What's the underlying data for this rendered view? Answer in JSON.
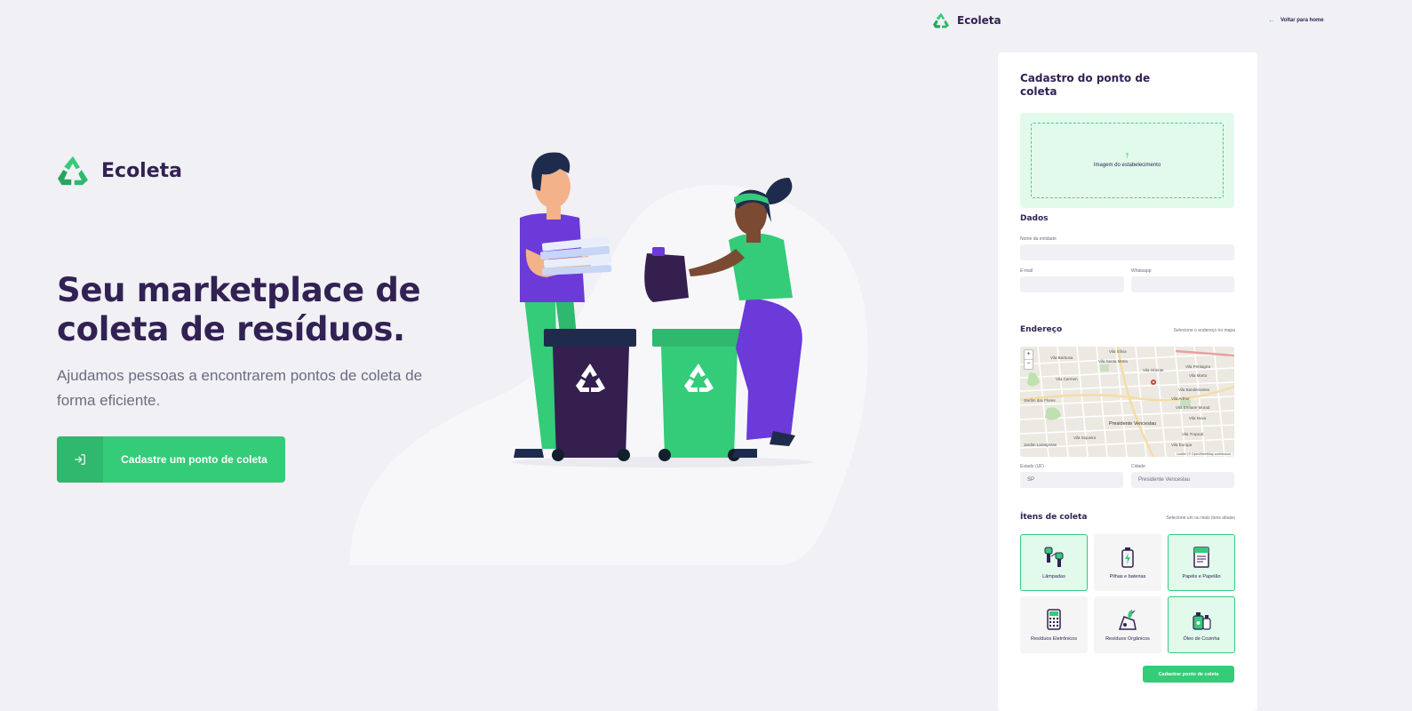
{
  "brand": {
    "name": "Ecoleta",
    "accent": "#34cb79",
    "title_color": "#322153"
  },
  "home": {
    "title": "Seu marketplace de coleta de resíduos.",
    "subtitle": "Ajudamos pessoas a encontrarem pontos de coleta de forma eficiente.",
    "cta_label": "Cadastre um ponto de coleta",
    "cta_icon": "log-in-icon"
  },
  "form_header": {
    "back_label": "Voltar para home",
    "back_icon": "arrow-left-icon"
  },
  "form": {
    "title": "Cadastro do ponto de coleta",
    "dropzone_label": "Imagem do estabelecimento",
    "dropzone_icon": "upload-icon",
    "dados": {
      "legend": "Dados",
      "name_label": "Nome da entidade",
      "email_label": "E-mail",
      "whatsapp_label": "Whatsapp"
    },
    "endereco": {
      "legend": "Endereço",
      "hint": "Selecione o endereço no mapa",
      "map": {
        "zoom_in": "+",
        "zoom_out": "−",
        "attribution": "Leaflet | © OpenStreetMap contributors",
        "city_label": "Presidente Venceslau",
        "street_labels": [
          "Vila Barbosa",
          "Vila Sílvia",
          "Vila Santa Maria",
          "Vila Oriente",
          "Vila Carmen",
          "Vila Pentagna",
          "Vila Marta",
          "Jardim das Flores",
          "Vila Bandeirantes",
          "Vila Arthur",
          "Vila Ermane Murad",
          "Vila Nova",
          "Vila Tropical",
          "Jardim Laranjeiras",
          "Vila Europa",
          "Vila Siqueira"
        ]
      },
      "uf_label": "Estado (UF)",
      "uf_value": "SP",
      "city_field_label": "Cidade",
      "city_value": "Presidente Venceslau"
    },
    "itens": {
      "legend": "Ítens de coleta",
      "hint": "Selecione um ou mais ítens abaixo",
      "list": [
        {
          "label": "Lâmpadas",
          "icon": "lamp-icon",
          "selected": true
        },
        {
          "label": "Pilhas e baterias",
          "icon": "battery-icon",
          "selected": false
        },
        {
          "label": "Papéis e Papelão",
          "icon": "paper-icon",
          "selected": true
        },
        {
          "label": "Resíduos Eletrônicos",
          "icon": "calculator-icon",
          "selected": false
        },
        {
          "label": "Resíduos Orgânicos",
          "icon": "organic-icon",
          "selected": false
        },
        {
          "label": "Óleo de Cozinha",
          "icon": "oil-bottle-icon",
          "selected": true
        }
      ]
    },
    "submit_label": "Cadastrar ponto de coleta"
  }
}
